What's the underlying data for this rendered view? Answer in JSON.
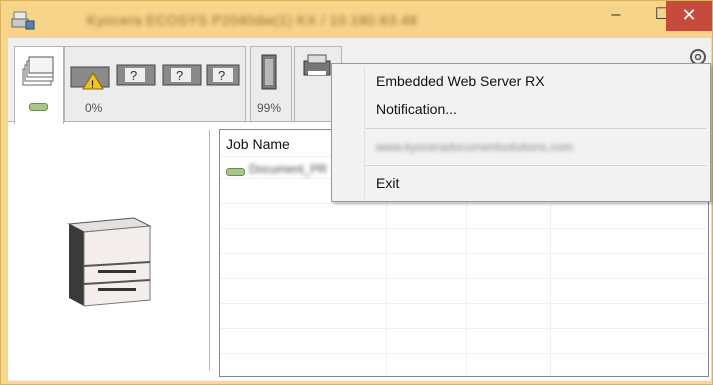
{
  "window": {
    "title": "Kyocera ECOSYS P2040dw(1) KX / 10.180.63.48",
    "controls": {
      "minimize": "–",
      "maximize": "☐",
      "close": "✕"
    }
  },
  "tabs": [
    {
      "id": "jobs",
      "label": ""
    },
    {
      "id": "toner",
      "label": "0%"
    },
    {
      "id": "paper",
      "label": "99%"
    },
    {
      "id": "device",
      "label": ""
    }
  ],
  "joblist": {
    "columns": [
      "Job Name"
    ],
    "rows": [
      {
        "name": "Document_PR"
      }
    ]
  },
  "context_menu": {
    "items": [
      {
        "id": "web-server",
        "label": "Embedded Web Server RX"
      },
      {
        "id": "notification",
        "label": "Notification..."
      },
      {
        "id": "url",
        "label": "www.kyoceradocumentsolutions.com"
      },
      {
        "id": "exit",
        "label": "Exit"
      }
    ]
  },
  "colors": {
    "titlebar": "#f6d48a",
    "close_button": "#c74b3c",
    "status_led": "#a7c78a"
  }
}
